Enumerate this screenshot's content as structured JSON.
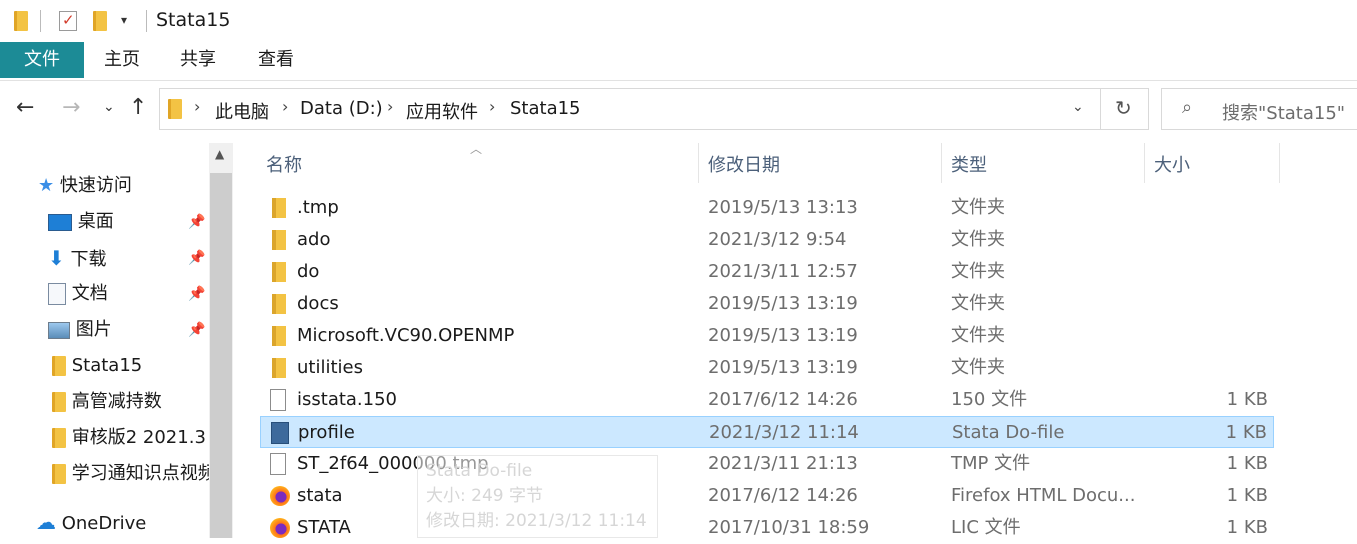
{
  "titlebar": {
    "title": "Stata15"
  },
  "ribbon": {
    "tabs": [
      "文件",
      "主页",
      "共享",
      "查看"
    ]
  },
  "address": {
    "crumbs": [
      "此电脑",
      "Data (D:)",
      "应用软件",
      "Stata15"
    ]
  },
  "search": {
    "placeholder": "搜索\"Stata15\""
  },
  "nav": {
    "quick_access": "快速访问",
    "items": [
      {
        "label": "桌面",
        "icon": "desktop-icon",
        "pinned": true
      },
      {
        "label": "下载",
        "icon": "download-icon",
        "pinned": true
      },
      {
        "label": "文档",
        "icon": "document-icon",
        "pinned": true
      },
      {
        "label": "图片",
        "icon": "picture-icon",
        "pinned": true
      },
      {
        "label": "Stata15",
        "icon": "folder-icon",
        "pinned": false
      },
      {
        "label": "高管减持数",
        "icon": "folder-icon",
        "pinned": false
      },
      {
        "label": "审核版2  2021.3",
        "icon": "folder-icon",
        "pinned": false
      },
      {
        "label": "学习通知识点视频",
        "icon": "folder-icon",
        "pinned": false
      }
    ],
    "onedrive": "OneDrive"
  },
  "columns": {
    "name": "名称",
    "date": "修改日期",
    "type": "类型",
    "size": "大小"
  },
  "files": [
    {
      "name": ".tmp",
      "date": "2019/5/13 13:13",
      "type": "文件夹",
      "size": "",
      "icon": "folder"
    },
    {
      "name": "ado",
      "date": "2021/3/12 9:54",
      "type": "文件夹",
      "size": "",
      "icon": "folder"
    },
    {
      "name": "do",
      "date": "2021/3/11 12:57",
      "type": "文件夹",
      "size": "",
      "icon": "folder"
    },
    {
      "name": "docs",
      "date": "2019/5/13 13:19",
      "type": "文件夹",
      "size": "",
      "icon": "folder"
    },
    {
      "name": "Microsoft.VC90.OPENMP",
      "date": "2019/5/13 13:19",
      "type": "文件夹",
      "size": "",
      "icon": "folder"
    },
    {
      "name": "utilities",
      "date": "2019/5/13 13:19",
      "type": "文件夹",
      "size": "",
      "icon": "folder"
    },
    {
      "name": "isstata.150",
      "date": "2017/6/12 14:26",
      "type": "150 文件",
      "size": "1 KB",
      "icon": "file"
    },
    {
      "name": "profile",
      "date": "2021/3/12 11:14",
      "type": "Stata Do-file",
      "size": "1 KB",
      "icon": "do",
      "selected": true
    },
    {
      "name": "ST_2f64_000000.tmp",
      "date": "2021/3/11 21:13",
      "type": "TMP 文件",
      "size": "1 KB",
      "icon": "file"
    },
    {
      "name": "stata",
      "date": "2017/6/12 14:26",
      "type": "Firefox HTML Docu...",
      "size": "1 KB",
      "icon": "ff"
    },
    {
      "name": "STATA",
      "date": "2017/10/31 18:59",
      "type": "LIC 文件",
      "size": "1 KB",
      "icon": "ff"
    }
  ],
  "tooltip": {
    "type": "Stata Do-file",
    "size": "大小: 249 字节",
    "modified": "修改日期: 2021/3/12 11:14"
  }
}
